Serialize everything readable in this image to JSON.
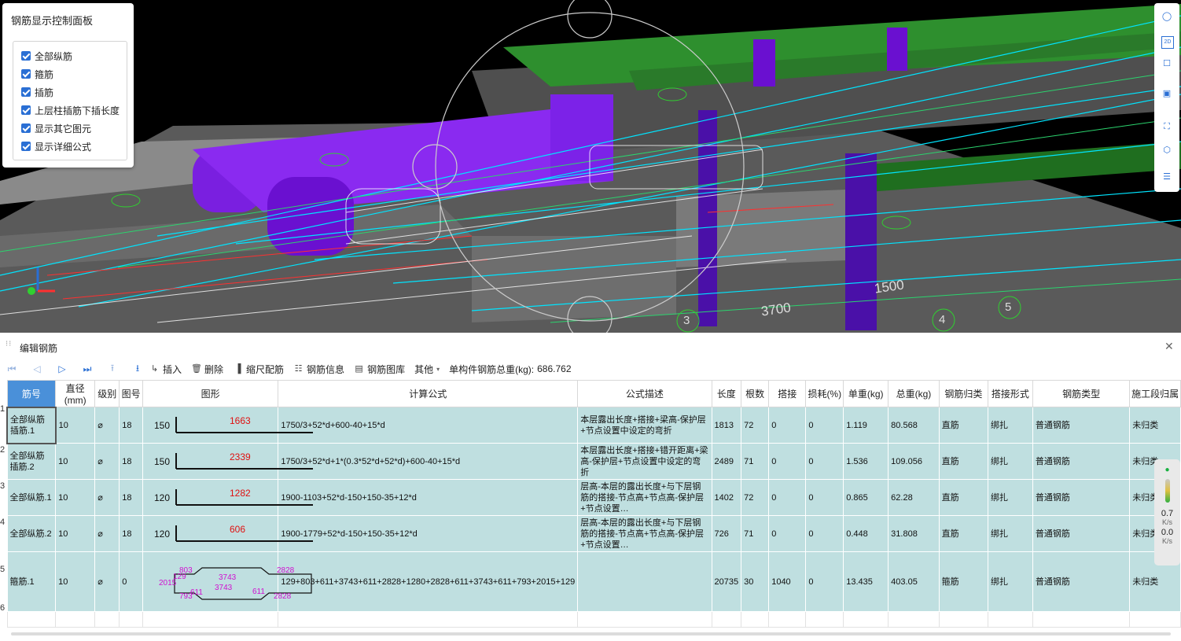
{
  "panel": {
    "title": "钢筋显示控制面板",
    "options": [
      {
        "label": "全部纵筋",
        "checked": true
      },
      {
        "label": "箍筋",
        "checked": true
      },
      {
        "label": "插筋",
        "checked": true
      },
      {
        "label": "上层柱插筋下插长度",
        "checked": true
      },
      {
        "label": "显示其它图元",
        "checked": true
      },
      {
        "label": "显示详细公式",
        "checked": true
      }
    ]
  },
  "viewport": {
    "labels": [
      "2D",
      "3700",
      "1500",
      "3",
      "4",
      "5"
    ]
  },
  "editor": {
    "title": "编辑钢筋",
    "toolbar": {
      "insert": "插入",
      "delete": "删除",
      "scale": "缩尺配筋",
      "info": "钢筋信息",
      "library": "钢筋图库",
      "other": "其他",
      "total_label": "单构件钢筋总重(kg):",
      "total_value": "686.762"
    },
    "columns": [
      "筋号",
      "直径(mm)",
      "级别",
      "图号",
      "图形",
      "计算公式",
      "公式描述",
      "长度",
      "根数",
      "搭接",
      "损耗(%)",
      "单重(kg)",
      "总重(kg)",
      "钢筋归类",
      "搭接形式",
      "钢筋类型",
      "施工段归属"
    ],
    "rows": [
      {
        "no": "1",
        "name": "全部纵筋插筋.1",
        "dia": "10",
        "grade": "⌀",
        "fig": "18",
        "left": "150",
        "mid": "1663",
        "formula": "1750/3+52*d+600-40+15*d",
        "desc": "本层露出长度+搭接+梁高-保护层+节点设置中设定的弯折",
        "len": "1813",
        "count": "72",
        "lap": "0",
        "loss": "0",
        "unit": "1.119",
        "total": "80.568",
        "cat": "直筋",
        "lapform": "绑扎",
        "type": "普通钢筋",
        "stage": "未归类"
      },
      {
        "no": "2",
        "name": "全部纵筋插筋.2",
        "dia": "10",
        "grade": "⌀",
        "fig": "18",
        "left": "150",
        "mid": "2339",
        "formula": "1750/3+52*d+1*(0.3*52*d+52*d)+600-40+15*d",
        "desc": "本层露出长度+搭接+错开距离+梁高-保护层+节点设置中设定的弯折",
        "len": "2489",
        "count": "71",
        "lap": "0",
        "loss": "0",
        "unit": "1.536",
        "total": "109.056",
        "cat": "直筋",
        "lapform": "绑扎",
        "type": "普通钢筋",
        "stage": "未归类"
      },
      {
        "no": "3",
        "name": "全部纵筋.1",
        "dia": "10",
        "grade": "⌀",
        "fig": "18",
        "left": "120",
        "mid": "1282",
        "formula": "1900-1103+52*d-150+150-35+12*d",
        "desc": "层高-本层的露出长度+与下层钢筋的搭接-节点高+节点高-保护层+节点设置…",
        "len": "1402",
        "count": "72",
        "lap": "0",
        "loss": "0",
        "unit": "0.865",
        "total": "62.28",
        "cat": "直筋",
        "lapform": "绑扎",
        "type": "普通钢筋",
        "stage": "未归类"
      },
      {
        "no": "4",
        "name": "全部纵筋.2",
        "dia": "10",
        "grade": "⌀",
        "fig": "18",
        "left": "120",
        "mid": "606",
        "formula": "1900-1779+52*d-150+150-35+12*d",
        "desc": "层高-本层的露出长度+与下层钢筋的搭接-节点高+节点高-保护层+节点设置…",
        "len": "726",
        "count": "71",
        "lap": "0",
        "loss": "0",
        "unit": "0.448",
        "total": "31.808",
        "cat": "直筋",
        "lapform": "绑扎",
        "type": "普通钢筋",
        "stage": "未归类"
      },
      {
        "no": "5",
        "name": "箍筋.1",
        "dia": "10",
        "grade": "⌀",
        "fig": "0",
        "left": "",
        "mid": "",
        "formula": "129+803+611+3743+611+2828+1280+2828+611+3743+611+793+2015+129",
        "desc": "",
        "len": "20735",
        "count": "30",
        "lap": "1040",
        "loss": "0",
        "unit": "13.435",
        "total": "403.05",
        "cat": "箍筋",
        "lapform": "绑扎",
        "type": "普通钢筋",
        "stage": "未归类"
      },
      {
        "no": "6",
        "name": "",
        "dia": "",
        "grade": "",
        "fig": "",
        "left": "",
        "mid": "",
        "formula": "",
        "desc": "",
        "len": "",
        "count": "",
        "lap": "",
        "loss": "",
        "unit": "",
        "total": "",
        "cat": "",
        "lapform": "",
        "type": "普通钢筋",
        "stage": ""
      }
    ],
    "stirrup_shape": {
      "a": "803",
      "b": "3743",
      "c": "2828",
      "d": "129",
      "e": "2015",
      "f": "3743",
      "g": "611",
      "h": "611",
      "i": "2828",
      "j": "793"
    }
  },
  "net": {
    "up": "0.7",
    "up_unit": "K/s",
    "down": "0.0",
    "down_unit": "K/s"
  }
}
